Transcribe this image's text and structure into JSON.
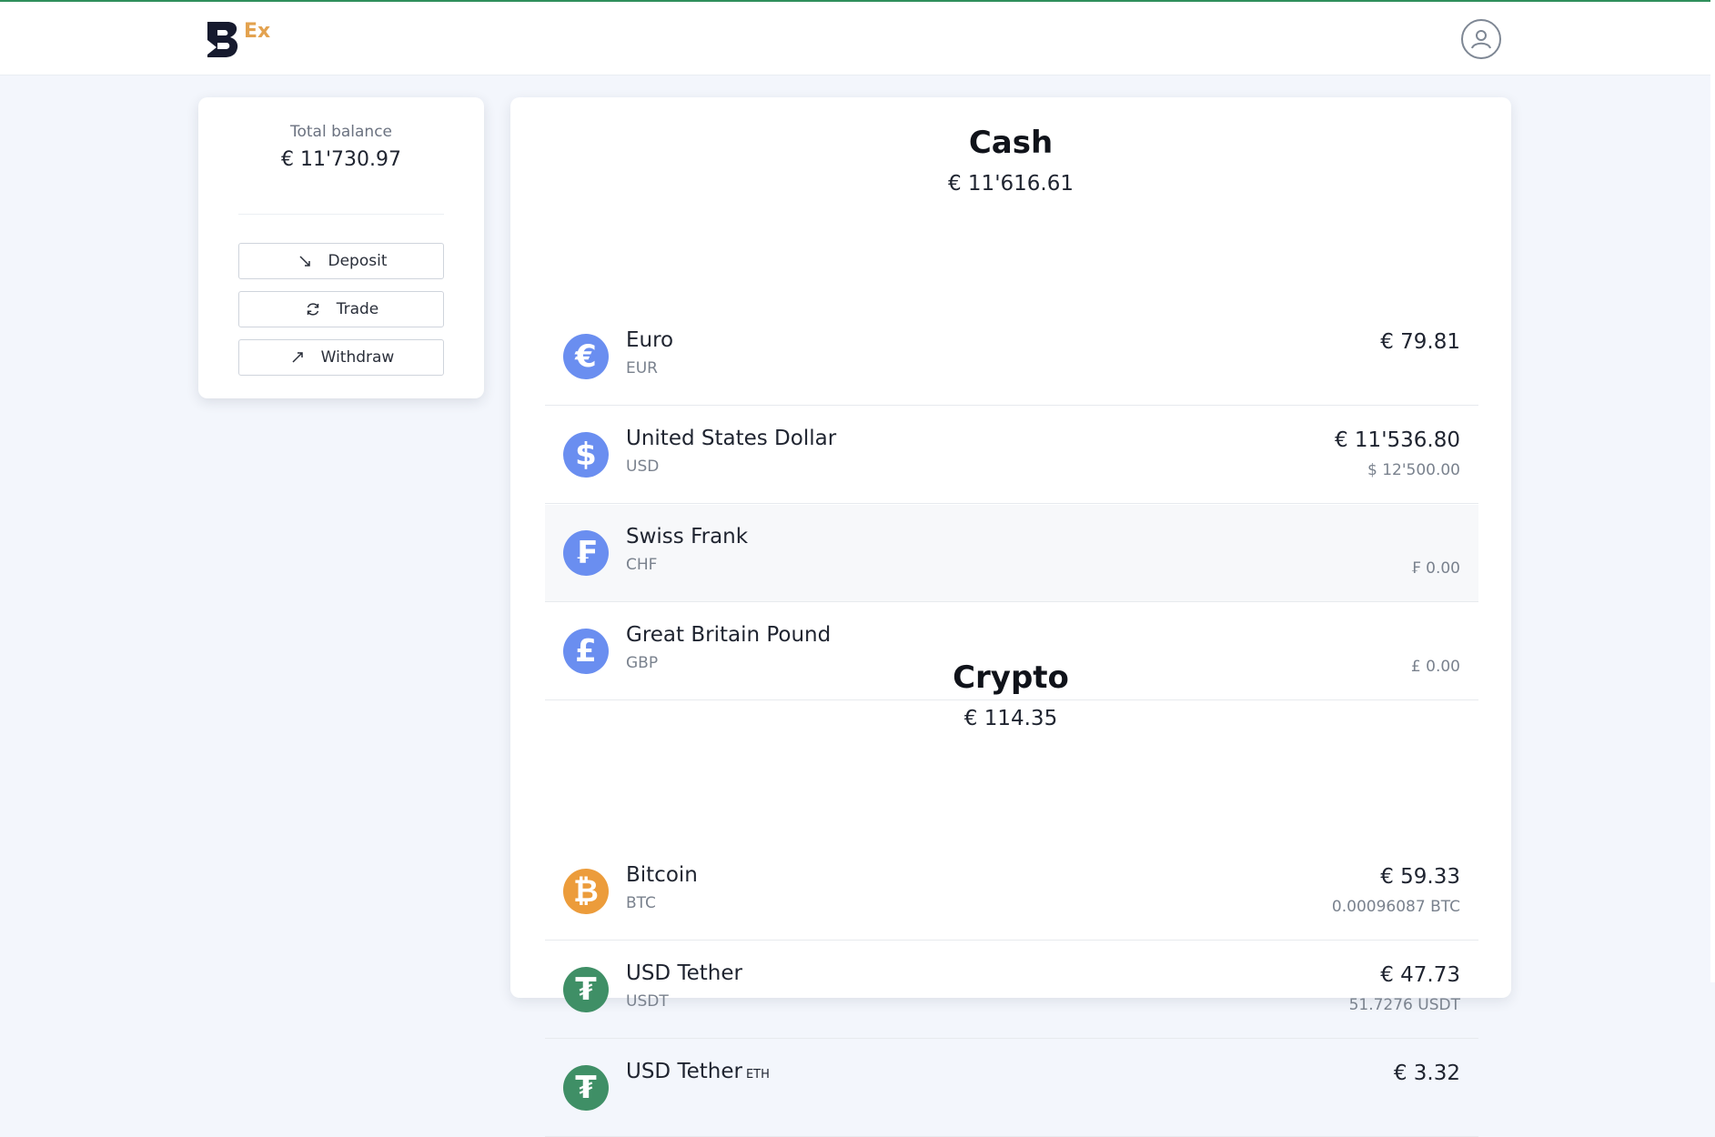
{
  "app": {
    "logo_suffix": "Ex",
    "brand_color": "#e3a24f",
    "accent_color": "#2f8f5b"
  },
  "header": {
    "profile_icon": "user-circle-icon"
  },
  "balance_card": {
    "label": "Total balance",
    "amount": "€ 11'730.97",
    "actions": [
      {
        "label": "Deposit",
        "icon": "arrow-down-right-icon"
      },
      {
        "label": "Trade",
        "icon": "refresh-icon"
      },
      {
        "label": "Withdraw",
        "icon": "arrow-up-right-icon"
      }
    ]
  },
  "cash": {
    "title": "Cash",
    "total": "€ 11'616.61",
    "items": [
      {
        "name": "Euro",
        "code": "EUR",
        "value": "€ 79.81",
        "sub": "",
        "symbol": "€",
        "color": "#6a8ef0"
      },
      {
        "name": "United States Dollar",
        "code": "USD",
        "value": "€ 11'536.80",
        "sub": "$ 12'500.00",
        "symbol": "$",
        "color": "#6a8ef0"
      },
      {
        "name": "Swiss Frank",
        "code": "CHF",
        "value": "",
        "sub": "₣ 0.00",
        "symbol": "₣",
        "color": "#6a8ef0"
      },
      {
        "name": "Great Britain Pound",
        "code": "GBP",
        "value": "",
        "sub": "£ 0.00",
        "symbol": "£",
        "color": "#6a8ef0"
      }
    ]
  },
  "crypto": {
    "title": "Crypto",
    "total": "€ 114.35",
    "items": [
      {
        "name": "Bitcoin",
        "code": "BTC",
        "value": "€ 59.33",
        "sub": "0.00096087 BTC",
        "symbol": "₿",
        "color": "#ec9c3b"
      },
      {
        "name": "USD Tether",
        "code": "USDT",
        "value": "€ 47.73",
        "sub": "51.7276 USDT",
        "symbol": "₮",
        "color": "#3f8f66"
      },
      {
        "name": "USD Tether",
        "tag": "ETH",
        "code": "",
        "value": "€ 3.32",
        "sub": "",
        "symbol": "₮",
        "color": "#3f8f66"
      }
    ]
  }
}
